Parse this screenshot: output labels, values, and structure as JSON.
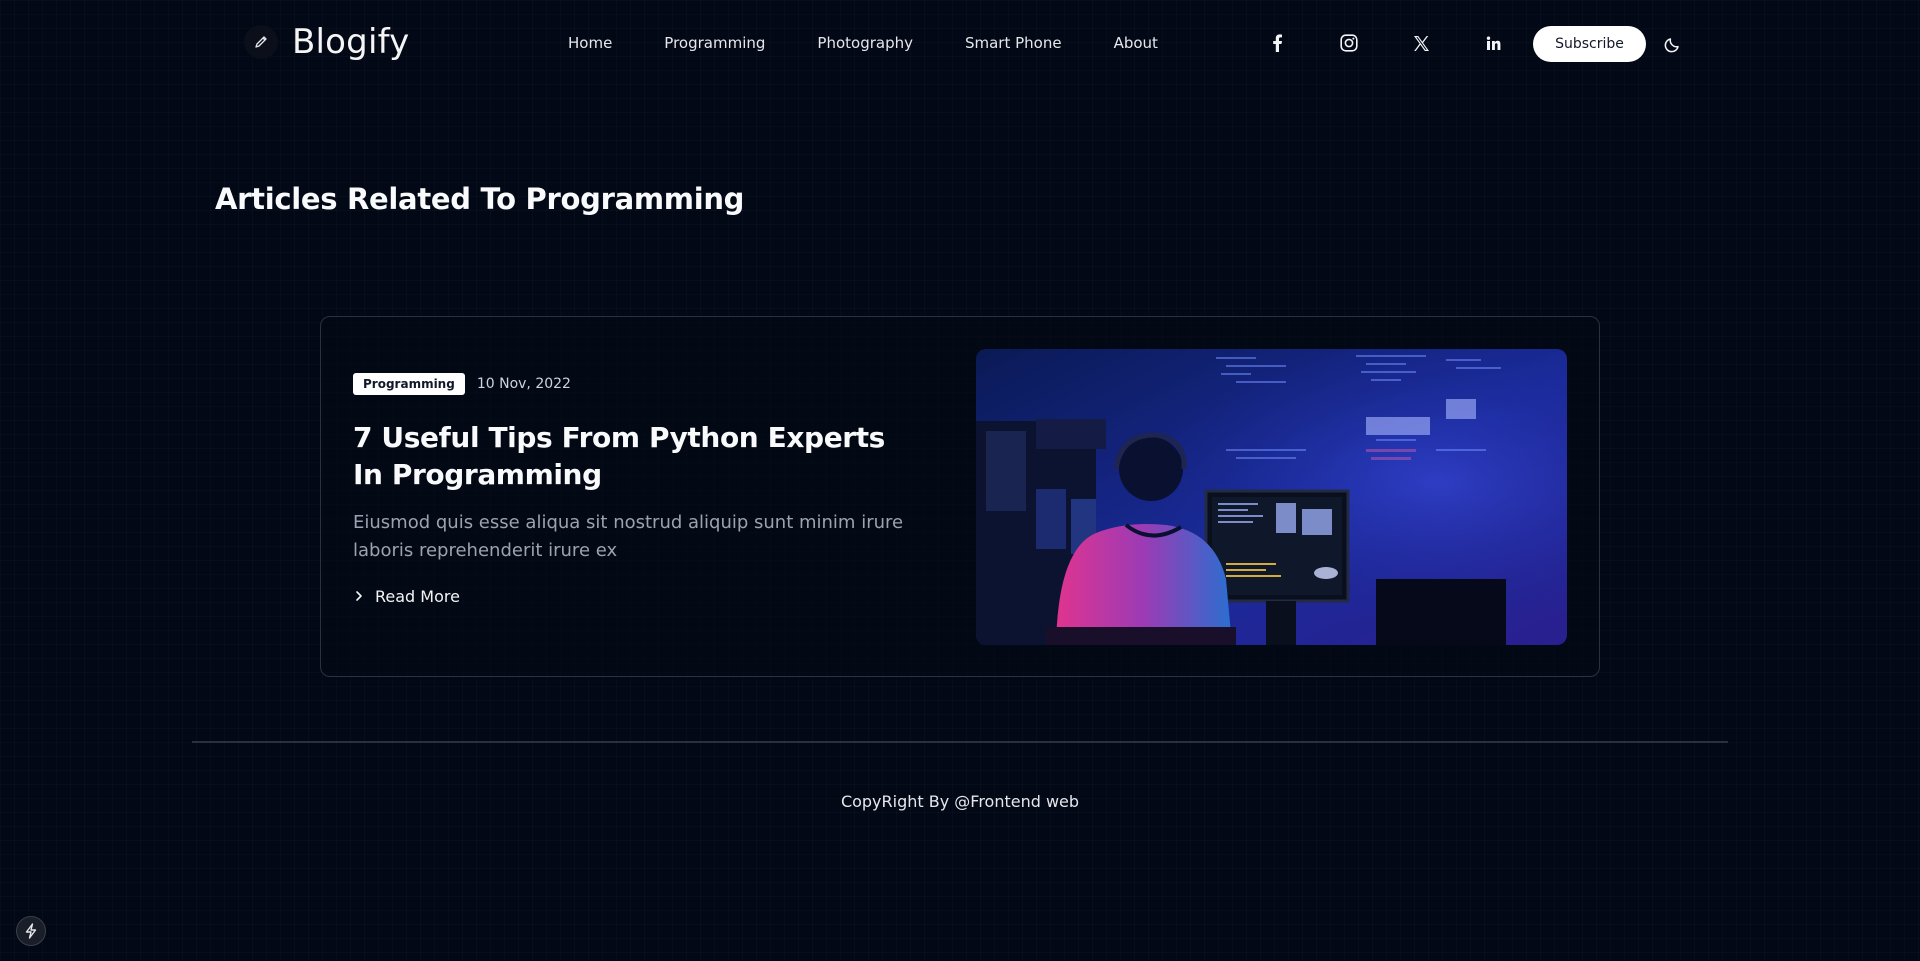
{
  "header": {
    "brand": "Blogify",
    "logo_icon": "pencil-icon",
    "nav": [
      "Home",
      "Programming",
      "Photography",
      "Smart Phone",
      "About"
    ],
    "social_icons": [
      "facebook-icon",
      "instagram-icon",
      "x-icon",
      "linkedin-icon"
    ],
    "subscribe_label": "Subscribe",
    "theme_icon": "moon-icon"
  },
  "page": {
    "title": "Articles Related To Programming"
  },
  "article": {
    "tag": "Programming",
    "date": "10 Nov, 2022",
    "title": "7 Useful Tips From Python Experts In Programming",
    "description": "Eiusmod quis esse aliqua sit nostrud aliquip sunt minim irure laboris reprehenderit irure ex",
    "read_more": "Read More",
    "image_icon": "programmer-at-computer-photo"
  },
  "footer": {
    "copyright": "CopyRight By @Frontend web"
  },
  "colors": {
    "background": "#030816",
    "card_border": "#2b3140",
    "muted_text": "#9ca3af"
  }
}
